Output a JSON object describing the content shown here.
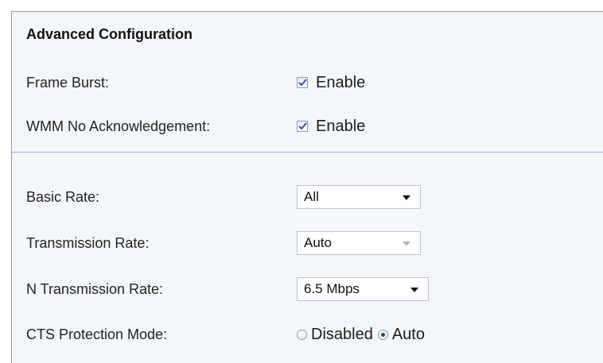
{
  "section": {
    "title": "Advanced Configuration"
  },
  "frame_burst": {
    "label": "Frame Burst:",
    "option": "Enable",
    "checked": true
  },
  "wmm_no_ack": {
    "label": "WMM No Acknowledgement:",
    "option": "Enable",
    "checked": true
  },
  "basic_rate": {
    "label": "Basic Rate:",
    "value": "All"
  },
  "transmission_rate": {
    "label": "Transmission Rate:",
    "value": "Auto",
    "disabled": true
  },
  "n_transmission_rate": {
    "label": "N Transmission Rate:",
    "value": "6.5 Mbps"
  },
  "cts_protection": {
    "label": "CTS Protection Mode:",
    "options": [
      "Disabled",
      "Auto"
    ],
    "selected": "Auto"
  },
  "colors": {
    "panel_bg": "#f4f7fa",
    "divider": "#9aa6d8",
    "check": "#2b5aa8"
  },
  "icons": {
    "check": "checkmark-icon",
    "dropdown": "chevron-down-icon"
  }
}
